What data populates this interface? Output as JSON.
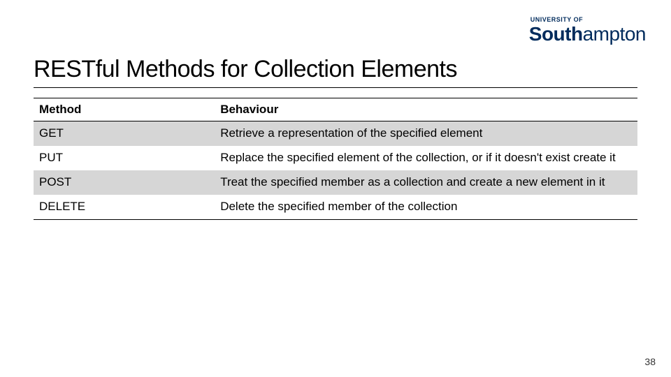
{
  "logo": {
    "top": "UNIVERSITY OF",
    "main_bold": "South",
    "main_rest": "ampton"
  },
  "title": "RESTful Methods for Collection Elements",
  "table": {
    "headers": {
      "method": "Method",
      "behaviour": "Behaviour"
    },
    "rows": [
      {
        "method": "GET",
        "behaviour": "Retrieve a representation of the specified element"
      },
      {
        "method": "PUT",
        "behaviour": "Replace the specified element of the collection, or if it doesn't exist create it"
      },
      {
        "method": "POST",
        "behaviour": "Treat the specified member as a collection and create a new element in it"
      },
      {
        "method": "DELETE",
        "behaviour": "Delete the specified member of the collection"
      }
    ]
  },
  "page_number": "38",
  "chart_data": {
    "type": "table",
    "title": "RESTful Methods for Collection Elements",
    "columns": [
      "Method",
      "Behaviour"
    ],
    "rows": [
      [
        "GET",
        "Retrieve a representation of the specified element"
      ],
      [
        "PUT",
        "Replace the specified element of the collection, or if it doesn't exist create it"
      ],
      [
        "POST",
        "Treat the specified member as a collection and create a new element in it"
      ],
      [
        "DELETE",
        "Delete the specified member of the collection"
      ]
    ]
  }
}
